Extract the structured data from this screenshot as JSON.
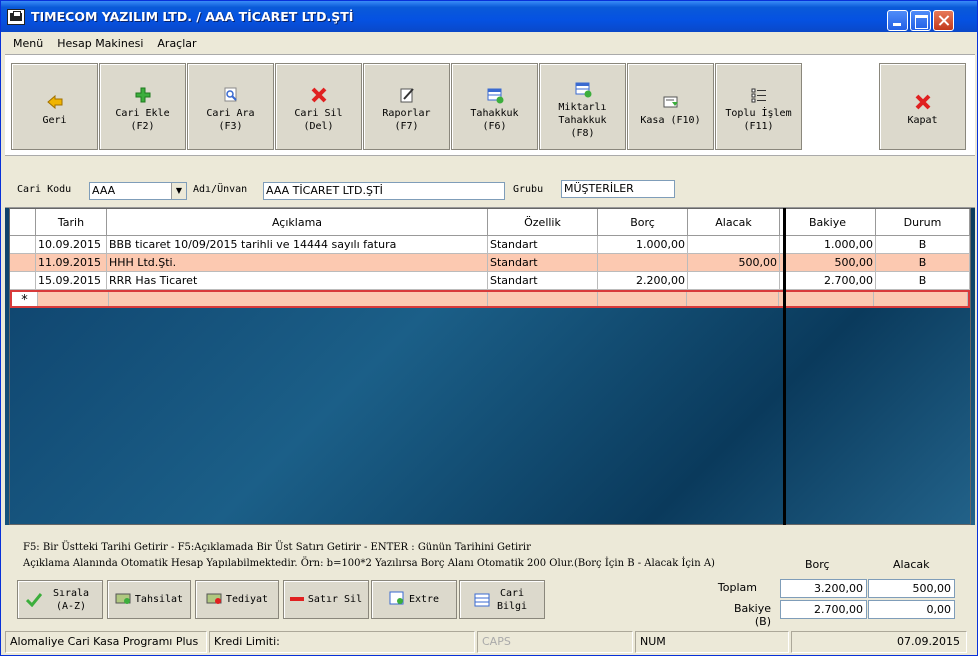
{
  "window": {
    "title": "TIMECOM YAZILIM LTD. / AAA TİCARET LTD.ŞTİ"
  },
  "menu": [
    "Menü",
    "Hesap Makinesi",
    "Araçlar"
  ],
  "toolbar": {
    "geri": [
      "Geri"
    ],
    "cari_ekle": [
      "Cari Ekle",
      "(F2)"
    ],
    "cari_ara": [
      "Cari Ara",
      "(F3)"
    ],
    "cari_sil": [
      "Cari Sil",
      "(Del)"
    ],
    "raporlar": [
      "Raporlar",
      "(F7)"
    ],
    "tahakkuk": [
      "Tahakkuk",
      "(F6)"
    ],
    "miktarli": [
      "Miktarlı",
      "Tahakkuk",
      "(F8)"
    ],
    "kasa": [
      "Kasa (F10)"
    ],
    "toplu": [
      "Toplu İşlem",
      "(F11)"
    ],
    "kapat": [
      "Kapat"
    ]
  },
  "form": {
    "cari_kodu_label": "Cari Kodu",
    "cari_kodu": "AAA",
    "adi_label": "Adı/Ünvan",
    "adi": "AAA TİCARET LTD.ŞTİ",
    "grubu_label": "Grubu",
    "grubu": "MÜŞTERİLER"
  },
  "grid": {
    "headers": [
      "Tarih",
      "Açıklama",
      "Özellik",
      "Borç",
      "Alacak",
      "Bakiye",
      "Durum"
    ],
    "rows": [
      [
        "10.09.2015",
        "BBB ticaret 10/09/2015 tarihli ve 14444 sayılı fatura",
        "Standart",
        "1.000,00",
        "",
        "1.000,00",
        "B"
      ],
      [
        "11.09.2015",
        "HHH Ltd.Şti.",
        "Standart",
        "",
        "500,00",
        "500,00",
        "B"
      ],
      [
        "15.09.2015",
        "RRR Has Ticaret",
        "Standart",
        "2.200,00",
        "",
        "2.700,00",
        "B"
      ]
    ],
    "new_row_marker": "*"
  },
  "info": {
    "line1": "F5: Bir Üstteki Tarihi Getirir - F5:Açıklamada Bir Üst Satırı Getirir - ENTER : Günün Tarihini Getirir",
    "line2": "Açıklama Alanında Otomatik Hesap Yapılabilmektedir. Örn: b=100*2 Yazılırsa Borç Alanı Otomatik 200 Olur.(Borç İçin B  -  Alacak İçin A)"
  },
  "bottom_buttons": {
    "sirala": [
      "Sırala",
      "(A-Z)"
    ],
    "tahsilat": [
      "Tahsilat"
    ],
    "tediyat": [
      "Tediyat"
    ],
    "satir_sil": [
      "Satır Sil"
    ],
    "extre": [
      "Extre"
    ],
    "cari_bilgi": [
      "Cari",
      "Bilgi"
    ]
  },
  "totals": {
    "borc_label": "Borç",
    "alacak_label": "Alacak",
    "toplam_label": "Toplam",
    "toplam_borc": "3.200,00",
    "toplam_alacak": "500,00",
    "bakiye_label": "Bakiye (B)",
    "bakiye_borc": "2.700,00",
    "bakiye_alacak": "0,00"
  },
  "status": {
    "app": "Alomaliye Cari Kasa Programı Plus",
    "kredi": "Kredi Limiti:",
    "caps": "CAPS",
    "num": "NUM",
    "date": "07.09.2015"
  },
  "colors": {
    "row_highlight": "#fcc9b1",
    "new_row_border": "#d83a3a",
    "titlebar": "#0552e2"
  }
}
